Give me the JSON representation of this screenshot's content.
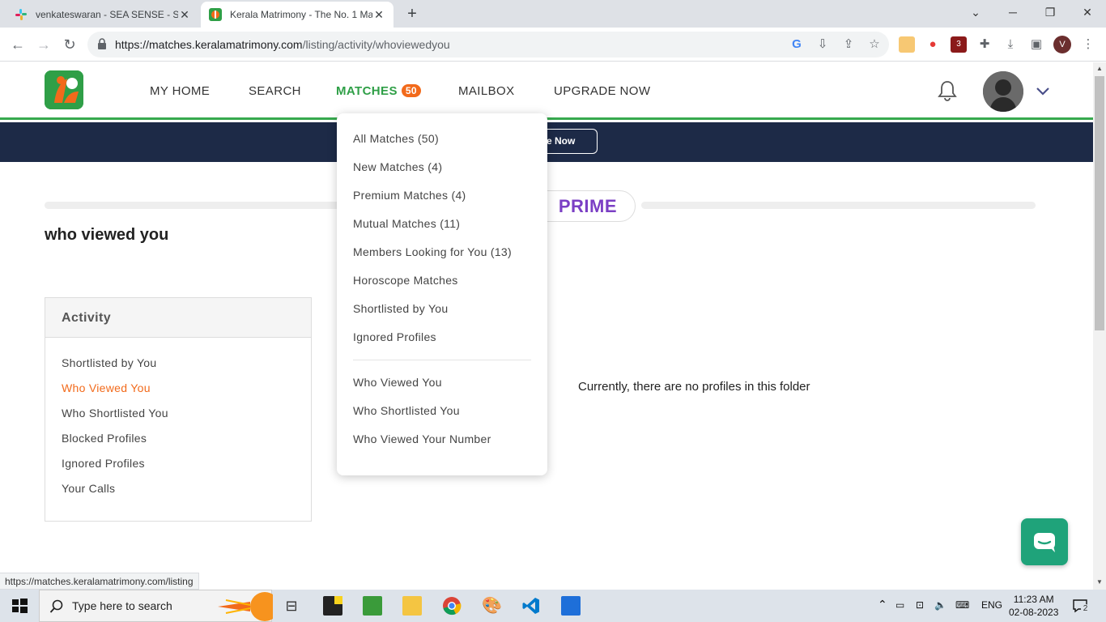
{
  "browser": {
    "tabs": [
      {
        "title": "venkateswaran - SEA SENSE - Sla",
        "active": false
      },
      {
        "title": "Kerala Matrimony - The No. 1 Ma",
        "active": true
      }
    ],
    "url_host": "https://matches.keralamatrimony.com",
    "url_path": "/listing/activity/whoviewedyou",
    "profile_initial": "V",
    "extension_badge": "3"
  },
  "header": {
    "nav": [
      {
        "label": "MY HOME"
      },
      {
        "label": "SEARCH"
      },
      {
        "label": "MATCHES",
        "badge": "50"
      },
      {
        "label": "MAILBOX"
      },
      {
        "label": "UPGRADE NOW"
      }
    ]
  },
  "promo": {
    "button_label": "de Now"
  },
  "prime": {
    "label": "PRIME"
  },
  "page": {
    "title": "who viewed you",
    "empty_message": "Currently, there are no profiles in this folder"
  },
  "activity": {
    "heading": "Activity",
    "items": [
      {
        "label": "Shortlisted by You"
      },
      {
        "label": "Who Viewed You",
        "selected": true
      },
      {
        "label": "Who Shortlisted You"
      },
      {
        "label": "Blocked Profiles"
      },
      {
        "label": "Ignored Profiles"
      },
      {
        "label": "Your Calls"
      }
    ]
  },
  "matches_menu": {
    "group1": [
      "All Matches (50)",
      "New Matches (4)",
      "Premium Matches (4)",
      "Mutual Matches (11)",
      "Members Looking for You (13)",
      "Horoscope Matches",
      "Shortlisted by You",
      "Ignored Profiles"
    ],
    "group2": [
      "Who Viewed You",
      "Who Shortlisted You",
      "Who Viewed Your Number"
    ]
  },
  "status_bar": {
    "url": "https://matches.keralamatrimony.com/listing"
  },
  "taskbar": {
    "search_placeholder": "Type here to search",
    "language": "ENG",
    "time": "11:23 AM",
    "date": "02-08-2023",
    "notification_count": "2"
  },
  "colors": {
    "brand_green": "#2f9f47",
    "accent_orange": "#f26a1b",
    "promo_navy": "#1d2a47",
    "prime_purple": "#7b3fc4"
  }
}
